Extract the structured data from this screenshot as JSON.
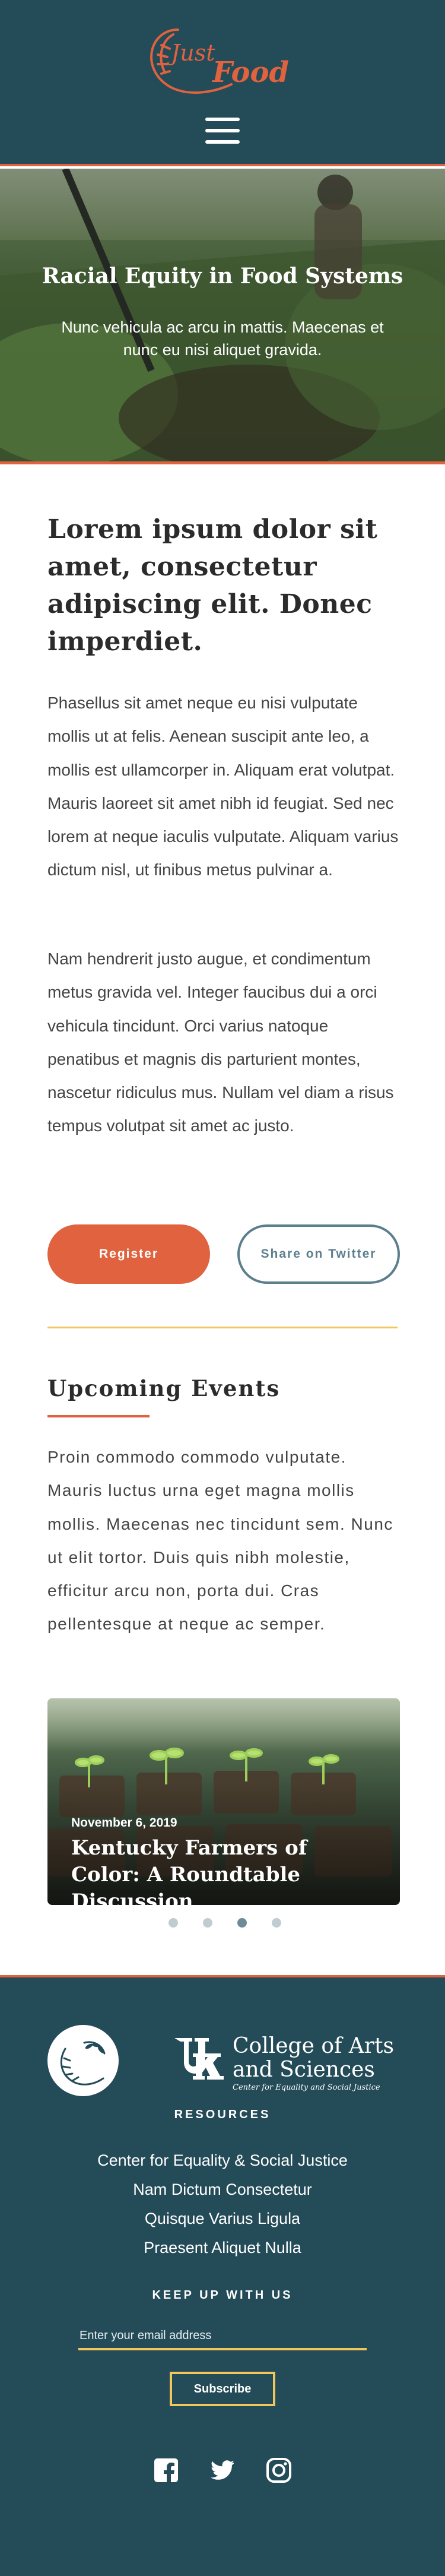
{
  "header": {
    "logo_text": "Just Food",
    "menu_icon": "hamburger-menu-icon",
    "background_color": "#244b58",
    "accent_color": "#e0623f"
  },
  "hero": {
    "title": "Racial Equity in Food Systems",
    "subtitle": "Nunc vehicula ac arcu in mattis. Maecenas et nunc eu nisi aliquet gravida."
  },
  "main": {
    "heading": "Lorem ipsum dolor sit amet, consectetur adipiscing elit. Donec imperdiet.",
    "paragraph_1": "Phasellus sit amet neque eu nisi vulputate mollis ut at felis. Aenean suscipit ante leo, a mollis est ullamcorper in. Aliquam erat volutpat. Mauris laoreet sit amet nibh id feugiat. Sed nec lorem at neque iaculis vulputate. Aliquam varius dictum nisl, ut finibus metus pulvinar a.",
    "paragraph_2": "Nam hendrerit justo augue, et condimentum metus gravida vel. Integer faucibus dui a orci vehicula tincidunt. Orci varius natoque penatibus et magnis dis parturient montes, nascetur ridiculus mus. Nullam vel diam a risus tempus volutpat sit amet ac justo.",
    "register_label": "Register",
    "share_label": "Share on Twitter"
  },
  "events": {
    "heading": "Upcoming Events",
    "description": "Proin commodo commodo vulputate. Mauris luctus urna eget magna mollis mollis. Maecenas nec tincidunt sem. Nunc ut elit tortor. Duis quis nibh molestie, efficitur arcu non, porta dui. Cras pellentesque at neque ac semper.",
    "card": {
      "date": "November 6, 2019",
      "title": "Kentucky Farmers of Color: A Roundtable Discussion"
    },
    "carousel": {
      "slide_count": 4,
      "active_index": 2
    }
  },
  "footer": {
    "emblem_icon": "wheat-wreath-icon",
    "uk_letters": "UK",
    "college_name_line1": "College of Arts",
    "college_name_line2": "and Sciences",
    "college_tagline": "Center for Equality and Social Justice",
    "resources_heading": "RESOURCES",
    "resources_links": [
      "Center for Equality & Social Justice",
      "Nam Dictum Consectetur",
      "Quisque Varius Ligula",
      "Praesent Aliquet Nulla"
    ],
    "keep_up_heading": "KEEP UP WITH US",
    "email_placeholder": "Enter your email address",
    "subscribe_label": "Subscribe",
    "social_icons": [
      "facebook-icon",
      "twitter-icon",
      "instagram-icon"
    ],
    "highlight_color": "#f2c65a"
  }
}
